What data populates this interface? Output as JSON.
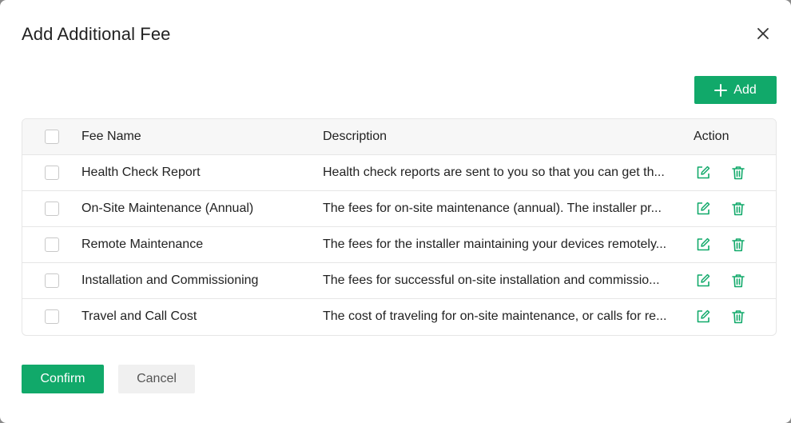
{
  "dialog": {
    "title": "Add Additional Fee",
    "close_icon": "close-icon"
  },
  "toolbar": {
    "add_label": "Add",
    "add_icon": "plus-icon"
  },
  "table": {
    "headers": {
      "fee_name": "Fee Name",
      "description": "Description",
      "action": "Action"
    },
    "rows": [
      {
        "name": "Health Check Report",
        "description": "Health check reports are sent to you so that you can get th..."
      },
      {
        "name": "On-Site Maintenance (Annual)",
        "description": "The fees for on-site maintenance (annual). The installer pr..."
      },
      {
        "name": "Remote Maintenance",
        "description": "The fees for the installer maintaining your devices remotely..."
      },
      {
        "name": "Installation and Commissioning",
        "description": "The fees for successful on-site installation and commissio..."
      },
      {
        "name": "Travel and Call Cost",
        "description": "The cost of traveling for on-site maintenance, or calls for re..."
      }
    ],
    "row_action_icons": [
      "edit-icon",
      "delete-icon"
    ]
  },
  "footer": {
    "confirm_label": "Confirm",
    "cancel_label": "Cancel"
  },
  "colors": {
    "accent": "#11a96a",
    "header_bg": "#f7f7f7",
    "border": "#e6e6e6"
  }
}
